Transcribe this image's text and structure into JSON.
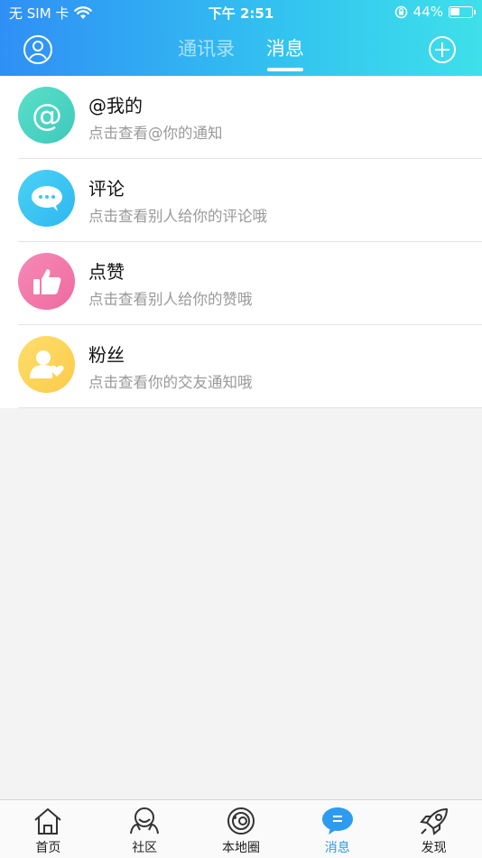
{
  "status_bar": {
    "carrier": "无 SIM 卡",
    "time": "下午 2:51",
    "battery": "44%",
    "battery_level": 0.44
  },
  "header": {
    "tabs": [
      {
        "label": "通讯录",
        "active": false
      },
      {
        "label": "消息",
        "active": true
      }
    ],
    "left_icon": "profile-icon",
    "right_icon": "add-circle-icon"
  },
  "messages": [
    {
      "title": "@我的",
      "subtitle": "点击查看@你的通知",
      "icon": "at-icon",
      "color": "#4dd4c0"
    },
    {
      "title": "评论",
      "subtitle": "点击查看别人给你的评论哦",
      "icon": "comment-icon",
      "color": "#3dc7f3"
    },
    {
      "title": "点赞",
      "subtitle": "点击查看别人给你的赞哦",
      "icon": "thumbs-up-icon",
      "color": "#f37aaa"
    },
    {
      "title": "粉丝",
      "subtitle": "点击查看你的交友通知哦",
      "icon": "fan-icon",
      "color": "#fdd55a"
    }
  ],
  "tabbar": [
    {
      "label": "首页",
      "icon": "home-icon",
      "active": false
    },
    {
      "label": "社区",
      "icon": "community-icon",
      "active": false
    },
    {
      "label": "本地圈",
      "icon": "local-circle-icon",
      "active": false
    },
    {
      "label": "消息",
      "icon": "message-icon",
      "active": true
    },
    {
      "label": "发现",
      "icon": "rocket-icon",
      "active": false
    }
  ],
  "colors": {
    "accent": "#2d9bf0",
    "header_start": "#2f8ff5",
    "header_end": "#3ee0ea"
  }
}
